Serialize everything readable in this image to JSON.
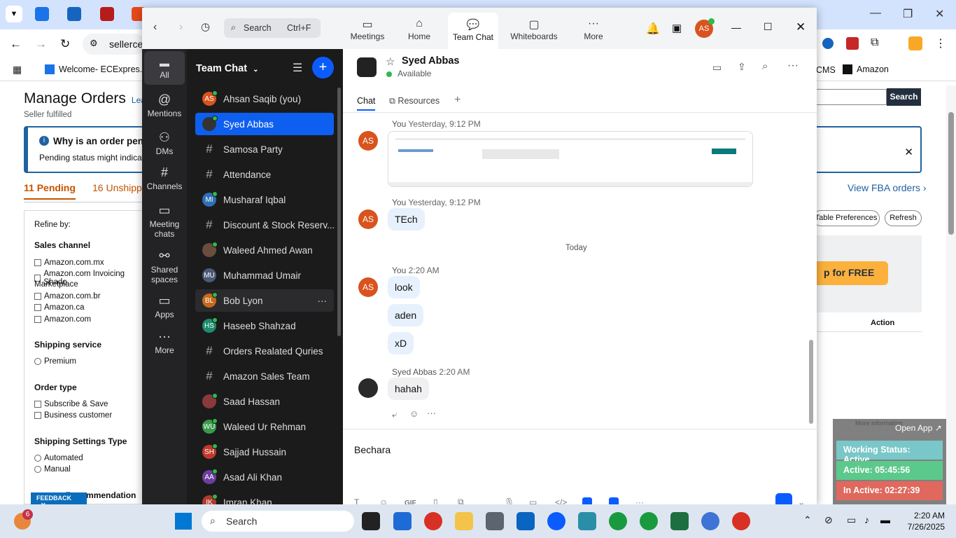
{
  "browser": {
    "address_partial": "sellerce",
    "bookmarks": [
      {
        "label": "Welcome- ECExpres..."
      },
      {
        "label": "CMS"
      },
      {
        "label": "Amazon"
      }
    ]
  },
  "seller": {
    "title": "Manage Orders",
    "title_link": "Lear",
    "subtitle": "Seller fulfilled",
    "banner_title": "Why is an order pen",
    "banner_text": "Pending status might indicate a",
    "tabs": [
      "11 Pending",
      "16 Unshippe"
    ],
    "search_button": "Search",
    "view_fba": "View FBA orders",
    "table_prefs": "Table Preferences",
    "refresh": "Refresh",
    "promo": "p for FREE",
    "action_col": "Action",
    "more_info": "More information",
    "filters": {
      "refine": "Refine by:",
      "sales_channel": "Sales channel",
      "channels": [
        "Amazon.com.mx",
        "Amazon.com Invoicing Shado",
        "Marketplace",
        "Amazon.com.br",
        "Amazon.ca",
        "Amazon.com"
      ],
      "shipping_service": "Shipping service",
      "premium": "Premium",
      "order_type": "Order type",
      "order_types": [
        "Subscribe & Save",
        "Business customer"
      ],
      "shipping_settings": "Shipping Settings Type",
      "settings_types": [
        "Automated",
        "Manual"
      ],
      "recommendation": "ry Recommendation"
    },
    "feedback": "FEEDBACK"
  },
  "zoom": {
    "search_label": "Search",
    "search_shortcut": "Ctrl+F",
    "top_tabs": [
      "Meetings",
      "Home",
      "Team Chat",
      "Whiteboards",
      "More"
    ],
    "avatar_initials": "AS",
    "sidebar": [
      "All",
      "Mentions",
      "DMs",
      "Channels",
      "Meeting chats",
      "Shared spaces",
      "Apps",
      "More"
    ],
    "list_title": "Team Chat",
    "list": [
      {
        "name": "Ahsan Saqib (you)",
        "kind": "avatar",
        "initials": "AS",
        "color": "#d9531e"
      },
      {
        "name": "Syed Abbas",
        "kind": "photo",
        "initials": "",
        "color": "#333"
      },
      {
        "name": "Samosa Party",
        "kind": "channel"
      },
      {
        "name": "Attendance",
        "kind": "channel"
      },
      {
        "name": "Musharaf Iqbal",
        "kind": "avatar",
        "initials": "MI",
        "color": "#2f6fb5"
      },
      {
        "name": "Discount & Stock Reserv...",
        "kind": "channel"
      },
      {
        "name": "Waleed Ahmed Awan",
        "kind": "photo",
        "initials": "",
        "color": "#6a4d3c"
      },
      {
        "name": "Muhammad Umair",
        "kind": "avatar",
        "initials": "MU",
        "color": "#4a5a78"
      },
      {
        "name": "Bob Lyon",
        "kind": "avatar",
        "initials": "BL",
        "color": "#c56a1c"
      },
      {
        "name": "Haseeb Shahzad",
        "kind": "avatar",
        "initials": "HS",
        "color": "#1f8a6e"
      },
      {
        "name": "Orders Realated Quries",
        "kind": "channel"
      },
      {
        "name": "Amazon Sales Team",
        "kind": "channel"
      },
      {
        "name": "Saad Hassan",
        "kind": "photo",
        "initials": "",
        "color": "#8a3a3a"
      },
      {
        "name": "Waleed Ur Rehman",
        "kind": "avatar",
        "initials": "WU",
        "color": "#3a9a4a"
      },
      {
        "name": "Sajjad Hussain",
        "kind": "avatar",
        "initials": "SH",
        "color": "#c0392b"
      },
      {
        "name": "Asad Ali Khan",
        "kind": "avatar",
        "initials": "AA",
        "color": "#6b3fa0"
      },
      {
        "name": "Imran Khan",
        "kind": "avatar",
        "initials": "IK",
        "color": "#b03a2e"
      }
    ],
    "chat": {
      "contact": "Syed Abbas",
      "status": "Available",
      "tabs": [
        "Chat",
        "Resources"
      ],
      "messages": [
        {
          "sender": "You",
          "time": "Yesterday, 9:12 PM"
        },
        {
          "sender": "You",
          "time": "Yesterday, 9:12 PM",
          "text": "TEch"
        },
        {
          "divider": "Today"
        },
        {
          "sender": "You",
          "time": "2:20 AM",
          "texts": [
            "look",
            "aden",
            "xD"
          ]
        },
        {
          "sender": "Syed Abbas",
          "time": "2:20 AM",
          "text": "hahah"
        }
      ],
      "compose_text": "Bechara"
    }
  },
  "widget": {
    "open_app": "Open App",
    "working": "Working Status: Active",
    "active": "Active: 05:45:56",
    "inactive": "In Active: 02:27:39"
  },
  "taskbar": {
    "search": "Search",
    "badge": "6",
    "time": "2:20 AM",
    "date": "7/26/2025"
  }
}
